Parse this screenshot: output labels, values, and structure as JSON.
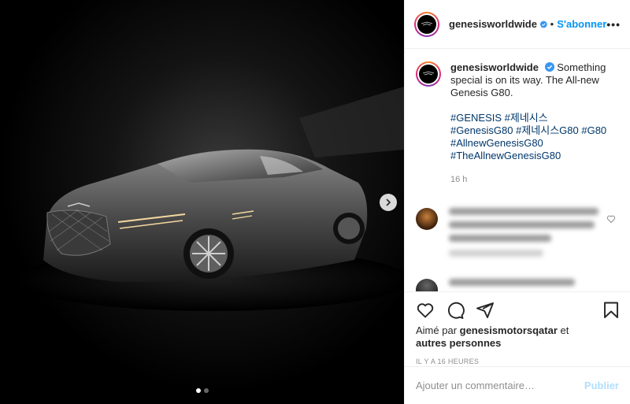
{
  "header": {
    "username": "genesisworldwide",
    "separator": "•",
    "follow_label": "S'abonner",
    "more_label": "•••"
  },
  "caption": {
    "username": "genesisworldwide",
    "text": "Something special is on its way. The All-new Genesis G80.",
    "hashtags": [
      "#GENESIS #제네시스",
      "#GenesisG80 #제네시스G80 #G80",
      "#AllnewGenesisG80",
      "#TheAllnewGenesisG80"
    ],
    "time": "16 h"
  },
  "likes": {
    "prefix": "Aimé par ",
    "user": "genesismotorsqatar",
    "suffix": " et",
    "others": "autres personnes"
  },
  "timestamp": "IL Y A 16 HEURES",
  "comment_input": {
    "placeholder": "Ajouter un commentaire…",
    "publish_label": "Publier"
  },
  "carousel": {
    "slide_count": 2,
    "active_index": 0
  },
  "colors": {
    "accent": "#0095f6",
    "hashtag": "#00376b",
    "publish_disabled": "#b2dffc",
    "verified": "#3897f0"
  },
  "icons": [
    "heart-icon",
    "comment-icon",
    "share-icon",
    "bookmark-icon",
    "chevron-right-icon",
    "verified-icon"
  ]
}
